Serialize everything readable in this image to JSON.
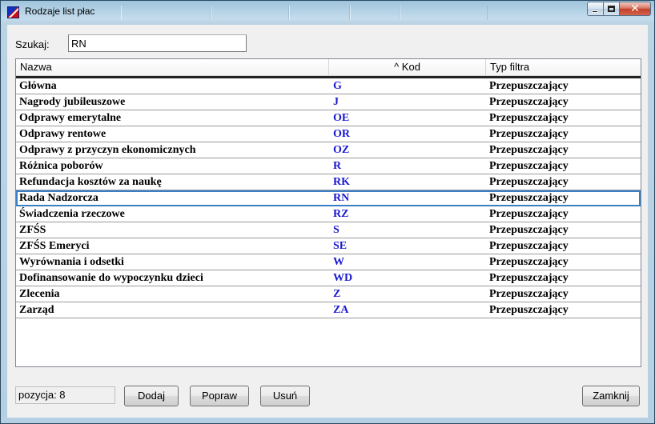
{
  "window": {
    "title": "Rodzaje list płac",
    "icon": "app-logo-icon",
    "close_glyph": "✕"
  },
  "search": {
    "label": "Szukaj:",
    "value": "RN"
  },
  "grid": {
    "columns": {
      "name": "Nazwa",
      "code": "^ Kod",
      "filter": "Typ filtra"
    },
    "selected_index": 7,
    "rows": [
      {
        "name": "Główna",
        "code": "G",
        "filter": "Przepuszczający"
      },
      {
        "name": "Nagrody jubileuszowe",
        "code": "J",
        "filter": "Przepuszczający"
      },
      {
        "name": "Odprawy emerytalne",
        "code": "OE",
        "filter": "Przepuszczający"
      },
      {
        "name": "Odprawy rentowe",
        "code": "OR",
        "filter": "Przepuszczający"
      },
      {
        "name": "Odprawy z przyczyn ekonomicznych",
        "code": "OZ",
        "filter": "Przepuszczający"
      },
      {
        "name": "Różnica poborów",
        "code": "R",
        "filter": "Przepuszczający"
      },
      {
        "name": "Refundacja kosztów za naukę",
        "code": "RK",
        "filter": "Przepuszczający"
      },
      {
        "name": "Rada Nadzorcza",
        "code": "RN",
        "filter": "Przepuszczający"
      },
      {
        "name": "Świadczenia rzeczowe",
        "code": "RZ",
        "filter": "Przepuszczający"
      },
      {
        "name": "ZFŚS",
        "code": "S",
        "filter": "Przepuszczający"
      },
      {
        "name": "ZFŚS Emeryci",
        "code": "SE",
        "filter": "Przepuszczający"
      },
      {
        "name": "Wyrównania i odsetki",
        "code": "W",
        "filter": "Przepuszczający"
      },
      {
        "name": "Dofinansowanie do wypoczynku dzieci",
        "code": "WD",
        "filter": "Przepuszczający"
      },
      {
        "name": "Zlecenia",
        "code": "Z",
        "filter": "Przepuszczający"
      },
      {
        "name": "Zarząd",
        "code": "ZA",
        "filter": "Przepuszczający"
      }
    ]
  },
  "footer": {
    "position_text": "pozycja:  8",
    "add_label": "Dodaj",
    "edit_label": "Popraw",
    "delete_label": "Usuń",
    "close_label": "Zamknij"
  },
  "colors": {
    "code_text": "#1a1ad0",
    "selection_outline": "#3a7fc6",
    "titlebar": "#c4dced"
  }
}
